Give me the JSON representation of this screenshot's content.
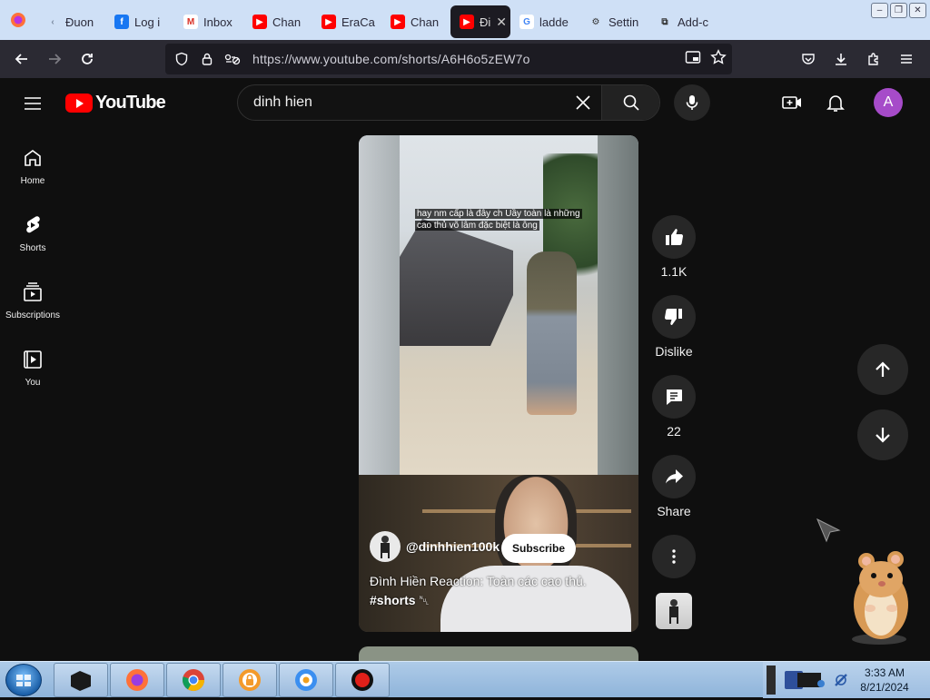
{
  "browser": {
    "tabs": [
      {
        "label": "Đuon",
        "favicon": "back-arrow-icon"
      },
      {
        "label": "Log i",
        "favicon": "facebook-icon"
      },
      {
        "label": "Inbox",
        "favicon": "gmail-icon"
      },
      {
        "label": "Chan",
        "favicon": "youtube-icon"
      },
      {
        "label": "EraCa",
        "favicon": "youtube-icon"
      },
      {
        "label": "Chan",
        "favicon": "youtube-icon"
      },
      {
        "label": "Đi",
        "favicon": "youtube-icon",
        "active": true
      },
      {
        "label": "ladde",
        "favicon": "google-icon"
      },
      {
        "label": "Settin",
        "favicon": "gear-icon"
      },
      {
        "label": "Add-c",
        "favicon": "puzzle-icon"
      }
    ],
    "url": "https://www.youtube.com/shorts/A6H6o5zEW7o"
  },
  "youtube": {
    "logo_text": "YouTube",
    "search_value": "dinh hien",
    "avatar_letter": "A",
    "accent": "#ff0000",
    "avatar_color": "#a64bc9"
  },
  "sidebar": {
    "items": [
      {
        "label": "Home",
        "icon": "home-icon"
      },
      {
        "label": "Shorts",
        "icon": "shorts-icon"
      },
      {
        "label": "Subscriptions",
        "icon": "subscriptions-icon"
      },
      {
        "label": "You",
        "icon": "you-icon"
      }
    ]
  },
  "short": {
    "caption_line1": "hay nm cấp là đây ch Uầy toàn là những",
    "caption_line2": "cao thủ võ lâm đặc biệt là ông",
    "channel_handle": "@dinhhien100k",
    "subscribe_label": "Subscribe",
    "title": "Đình Hiền Reaction: Toàn các cao thủ.",
    "hashtag": "#shorts",
    "hashtag_suffix": "␀"
  },
  "actions": {
    "like_count": "1.1K",
    "dislike_label": "Dislike",
    "comment_count": "22",
    "share_label": "Share"
  },
  "taskbar": {
    "time": "3:33 AM",
    "date": "8/21/2024"
  }
}
